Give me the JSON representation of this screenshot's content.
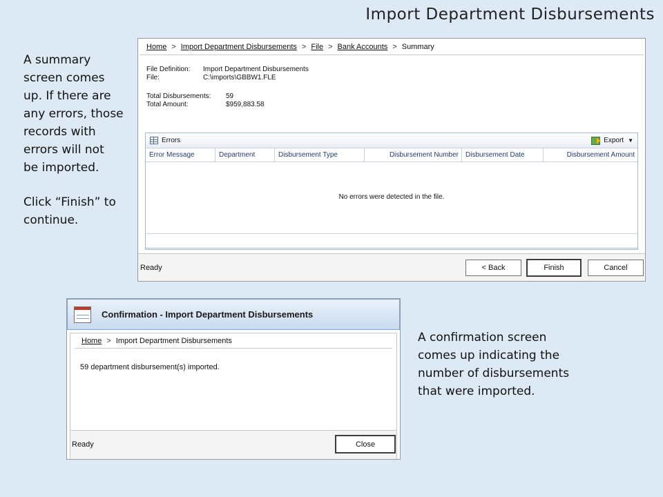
{
  "slide": {
    "title": "Import Department Disbursements",
    "left_caption": [
      "A summary\nscreen comes\nup.  If there are\nany errors, those\nrecords with\nerrors will not\nbe imported.",
      "Click “Finish” to\ncontinue."
    ],
    "right_caption": "A confirmation screen\ncomes up indicating the\nnumber of disbursements\nthat were imported."
  },
  "summary": {
    "breadcrumb": [
      "Home",
      "Import Department Disbursements",
      "File",
      "Bank Accounts",
      "Summary"
    ],
    "separator": ">",
    "file_definition_label": "File Definition:",
    "file_definition_value": "Import Department Disbursements",
    "file_label": "File:",
    "file_value": "C:\\imports\\GBBW1.FLE",
    "total_disbursements_label": "Total Disbursements:",
    "total_disbursements_value": "59",
    "total_amount_label": "Total Amount:",
    "total_amount_value": "$959,883.58",
    "errors": {
      "title": "Errors",
      "export_label": "Export",
      "columns": [
        "Error Message",
        "Department",
        "Disbursement Type",
        "Disbursement Number",
        "Disbursement Date",
        "Disbursement Amount"
      ],
      "empty_message": "No errors were detected in the file."
    },
    "status": "Ready",
    "buttons": {
      "back": "< Back",
      "finish": "Finish",
      "cancel": "Cancel"
    }
  },
  "confirmation": {
    "title": "Confirmation - Import Department Disbursements",
    "breadcrumb": [
      "Home",
      "Import Department Disbursements"
    ],
    "message": "59 department disbursement(s) imported.",
    "status": "Ready",
    "close_label": "Close"
  }
}
